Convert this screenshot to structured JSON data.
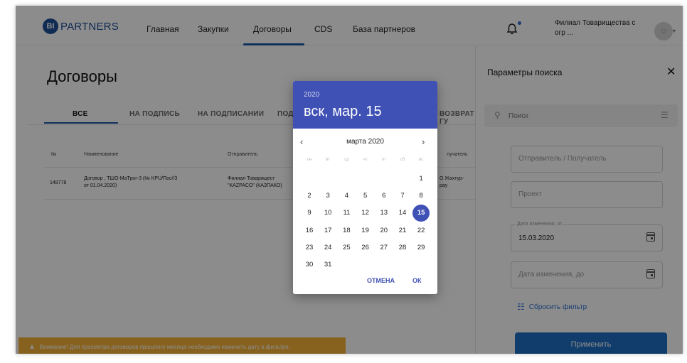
{
  "header": {
    "logo_mark": "BI",
    "logo_text": "PARTNERS",
    "nav": [
      "Главная",
      "Закупки",
      "Договоры",
      "CDS",
      "База партнеров"
    ],
    "branch_line1": "Филиал Товарищества с",
    "branch_line2": "огр ..."
  },
  "main": {
    "title": "Договоры",
    "tabs": [
      "ВСЕ",
      "НА ПОДПИСЬ",
      "НА ПОДПИСАНИИ",
      "ПОД",
      "ВОЗВРАТ ГУ"
    ],
    "columns": [
      "№",
      "Наименование",
      "Отправитель",
      "лучатель"
    ],
    "rows": [
      {
        "id": "148778",
        "name_line1": "Договор , ТШО-МаТрог-3 (№ KPU/Пос//3",
        "name_line2": "от 01.04.2020)",
        "sender_line1": "Филиал Товарищест",
        "sender_line2": "\"KAZPACO\" (КАЗПАКО)",
        "recipient_line1": "О Жахтур-",
        "recipient_line2": "рау"
      }
    ],
    "warning": "Внимание! Для просмотра договоров прошлого месяца необходимо изменить дату в фильтре."
  },
  "side_panel": {
    "title": "Параметры поиска",
    "close": "✕",
    "search_placeholder": "Поиск",
    "sender_placeholder": "Отправитель / Получатель",
    "project_placeholder": "Проект",
    "date_from_label": "Дата изменения, от",
    "date_from_value": "15.03.2020",
    "date_to_placeholder": "Дата изменения, до",
    "reset_label": "Сбросить фильтр",
    "apply_label": "Применить"
  },
  "date_picker": {
    "year": "2020",
    "selected_text": "вск, мар. 15",
    "month_label": "марта 2020",
    "weekdays": [
      "пн",
      "вт",
      "ср",
      "чт",
      "пт",
      "сб",
      "вс"
    ],
    "days": [
      "1",
      "2",
      "3",
      "4",
      "5",
      "6",
      "7",
      "8",
      "9",
      "10",
      "11",
      "12",
      "13",
      "14",
      "15",
      "16",
      "17",
      "18",
      "19",
      "20",
      "21",
      "22",
      "23",
      "24",
      "25",
      "26",
      "27",
      "28",
      "29",
      "30",
      "31"
    ],
    "first_weekday_index": 6,
    "selected_day": "15",
    "cancel_label": "ОТМЕНА",
    "ok_label": "ОК"
  },
  "colors": {
    "primary": "#3f51b5",
    "nav_accent": "#1e5aa8",
    "warning": "#f6b33a",
    "apply": "#1e6fc4"
  },
  "icons": {
    "bell": "bell-icon",
    "search": "search-icon",
    "filter": "filter-icon",
    "calendar": "calendar-icon",
    "close": "close-icon",
    "warning": "warning-icon"
  }
}
